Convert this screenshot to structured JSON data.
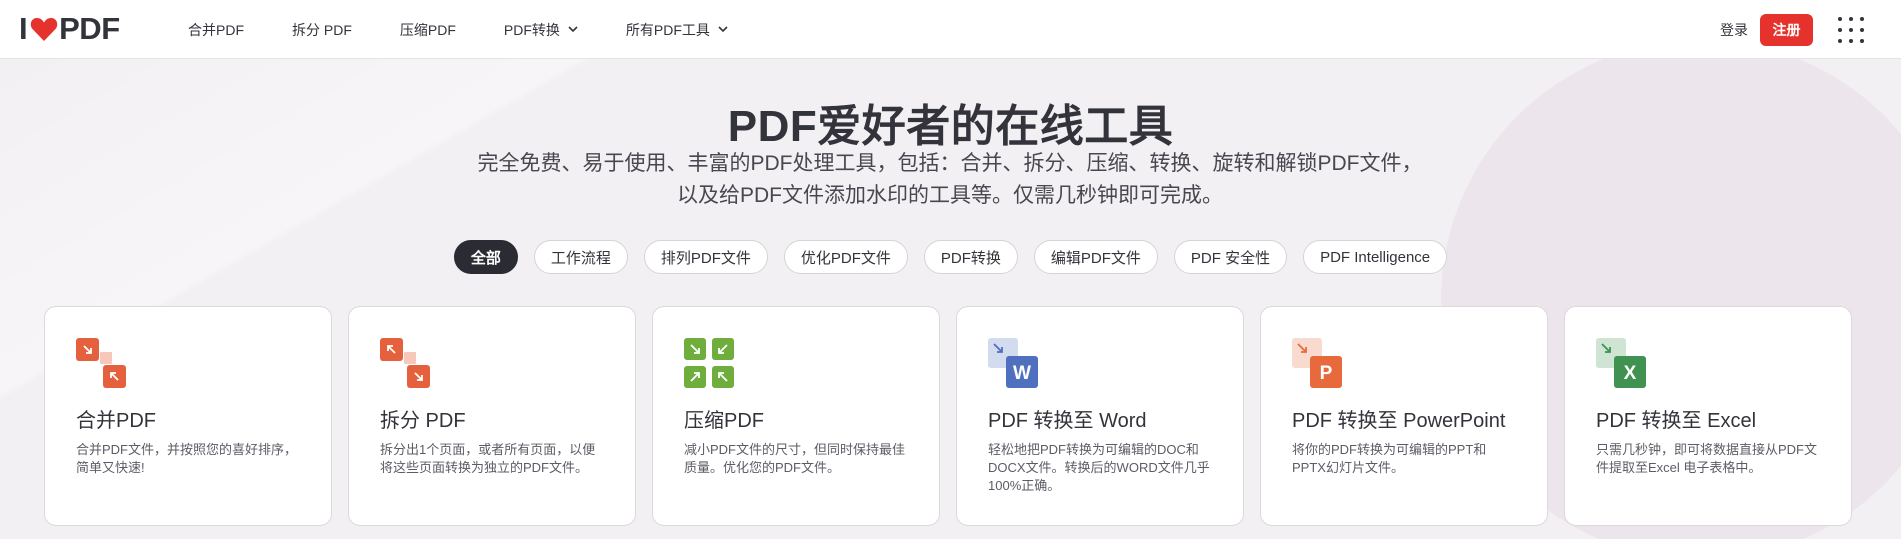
{
  "header": {
    "logo": {
      "left": "I",
      "right": "PDF"
    },
    "nav": [
      {
        "label": "合并PDF",
        "has_dropdown": false
      },
      {
        "label": "拆分 PDF",
        "has_dropdown": false
      },
      {
        "label": "压缩PDF",
        "has_dropdown": false
      },
      {
        "label": "PDF转换",
        "has_dropdown": true
      },
      {
        "label": "所有PDF工具",
        "has_dropdown": true
      }
    ],
    "login_label": "登录",
    "signup_label": "注册",
    "apps_icon": "grid-menu-icon"
  },
  "hero": {
    "title": "PDF爱好者的在线工具",
    "subtitle": "完全免费、易于使用、丰富的PDF处理工具，包括：合并、拆分、压缩、转换、旋转和解锁PDF文件，以及给PDF文件添加水印的工具等。仅需几秒钟即可完成。"
  },
  "filters": [
    {
      "label": "全部",
      "active": true
    },
    {
      "label": "工作流程",
      "active": false
    },
    {
      "label": "排列PDF文件",
      "active": false
    },
    {
      "label": "优化PDF文件",
      "active": false
    },
    {
      "label": "PDF转换",
      "active": false
    },
    {
      "label": "编辑PDF文件",
      "active": false
    },
    {
      "label": "PDF 安全性",
      "active": false
    },
    {
      "label": "PDF Intelligence",
      "active": false
    }
  ],
  "tools": [
    {
      "title": "合并PDF",
      "desc": "合并PDF文件，并按照您的喜好排序，简单又快速!",
      "icon": "merge-pdf-icon",
      "color": "#e5613d"
    },
    {
      "title": "拆分 PDF",
      "desc": "拆分出1个页面，或者所有页面，以便将这些页面转换为独立的PDF文件。",
      "icon": "split-pdf-icon",
      "color": "#e5613d"
    },
    {
      "title": "压缩PDF",
      "desc": "减小PDF文件的尺寸，但同时保持最佳质量。优化您的PDF文件。",
      "icon": "compress-pdf-icon",
      "color": "#6fae3c"
    },
    {
      "title": "PDF 转换至 Word",
      "desc": "轻松地把PDF转换为可编辑的DOC和DOCX文件。转换后的WORD文件几乎100%正确。",
      "icon": "pdf-to-word-icon",
      "color": "#4f6fbf",
      "letter": "W"
    },
    {
      "title": "PDF 转换至 PowerPoint",
      "desc": "将你的PDF转换为可编辑的PPT和PPTX幻灯片文件。",
      "icon": "pdf-to-powerpoint-icon",
      "color": "#e86a3c",
      "letter": "P"
    },
    {
      "title": "PDF 转换至 Excel",
      "desc": "只需几秒钟，即可将数据直接从PDF文件提取至Excel 电子表格中。",
      "icon": "pdf-to-excel-icon",
      "color": "#3f9250",
      "letter": "X"
    }
  ]
}
